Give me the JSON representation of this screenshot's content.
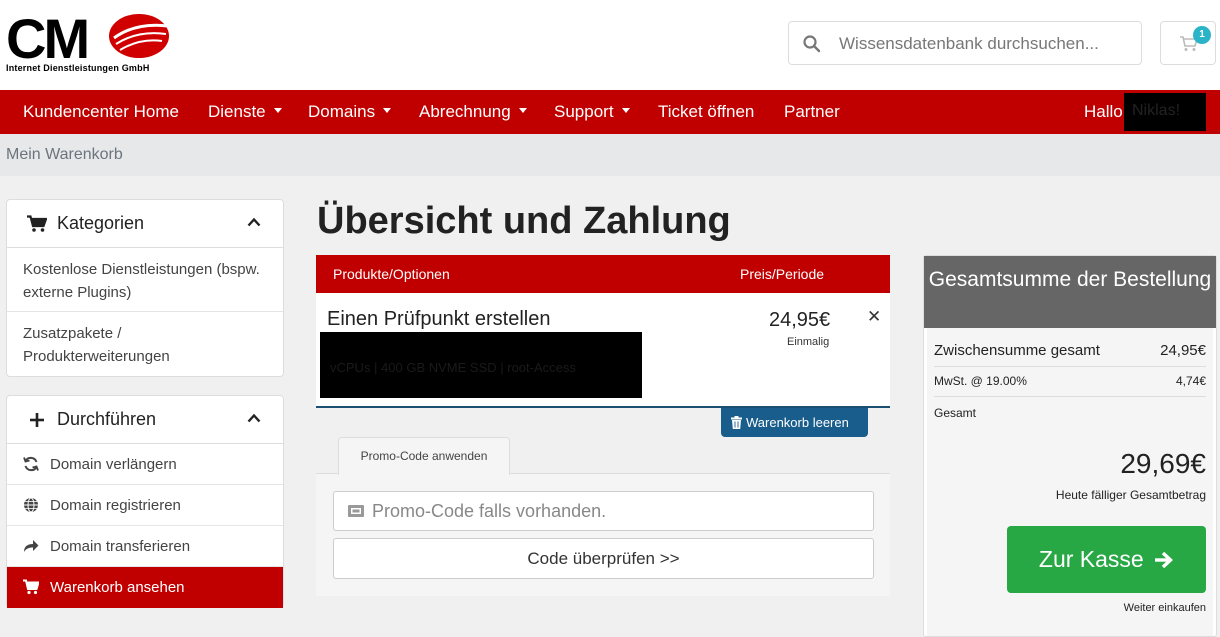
{
  "brand": {
    "logo_alt": "CMO",
    "logo_subtitle": "Internet Dienstleistungen GmbH",
    "colors": {
      "primary": "#c00000",
      "checkout": "#28a745",
      "badge": "#2bb3c7",
      "empty_cart": "#195d8c"
    }
  },
  "header": {
    "search_placeholder": "Wissensdatenbank durchsuchen...",
    "cart_count": "1"
  },
  "nav": {
    "items": [
      {
        "label": "Kundencenter Home",
        "dropdown": false
      },
      {
        "label": "Dienste",
        "dropdown": true
      },
      {
        "label": "Domains",
        "dropdown": true
      },
      {
        "label": "Abrechnung",
        "dropdown": true
      },
      {
        "label": "Support",
        "dropdown": true
      },
      {
        "label": "Ticket öffnen",
        "dropdown": false
      },
      {
        "label": "Partner",
        "dropdown": false
      }
    ],
    "greeting": "Hallo,",
    "user_name": "Niklas!"
  },
  "breadcrumb": {
    "current": "Mein Warenkorb"
  },
  "sidebar": {
    "categories": {
      "title": "Kategorien",
      "items": [
        "Kostenlose Dienstleistungen (bspw. externe Plugins)",
        "Zusatzpakete / Produkterweiterungen"
      ]
    },
    "actions": {
      "title": "Durchführen",
      "items": [
        {
          "label": "Domain verlängern",
          "icon": "refresh-icon",
          "active": false
        },
        {
          "label": "Domain registrieren",
          "icon": "globe-icon",
          "active": false
        },
        {
          "label": "Domain transferieren",
          "icon": "share-arrow-icon",
          "active": false
        },
        {
          "label": "Warenkorb ansehen",
          "icon": "cart-icon",
          "active": true
        }
      ]
    }
  },
  "main": {
    "title": "Übersicht und Zahlung",
    "table": {
      "col_products": "Produkte/Optionen",
      "col_price": "Preis/Periode"
    },
    "item": {
      "name": "Einen Prüfpunkt erstellen",
      "details_redacted": "vCPUs | 400 GB NVME SSD | root-Access",
      "price": "24,95€",
      "period": "Einmalig"
    },
    "empty_cart_label": "Warenkorb leeren",
    "promo": {
      "tab_label": "Promo-Code anwenden",
      "placeholder": "Promo-Code falls vorhanden.",
      "check_label": "Code überprüfen >>"
    }
  },
  "summary": {
    "title": "Gesamtsumme der Bestellung",
    "subtotal_label": "Zwischensumme gesamt",
    "subtotal_value": "24,95€",
    "tax_label": "MwSt. @ 19.00%",
    "tax_value": "4,74€",
    "total_label": "Gesamt",
    "total_value": "29,69€",
    "due_today_label": "Heute fälliger Gesamtbetrag",
    "checkout_label": "Zur Kasse",
    "continue_label": "Weiter einkaufen"
  }
}
